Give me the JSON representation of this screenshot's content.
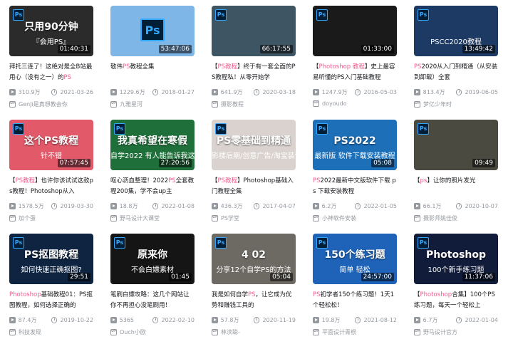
{
  "colors": {
    "highlight": "#f25d8e",
    "meta": "#9499a0",
    "ps_blue": "#31a8ff",
    "ps_dark": "#001e36"
  },
  "videos": [
    {
      "cover_text": "只用90分钟",
      "cover_sub": "『会用PS』",
      "duration": "01:40:31",
      "title_pre": "拜托三连了！这绝对是全B站最用心（没有之一）的",
      "title_hl": "PS",
      "title_post": "",
      "views": "310.9万",
      "date": "2021-03-26",
      "author": "GenJi是真想教会你",
      "bg": "#2b2b2b"
    },
    {
      "cover_text": "",
      "cover_sub": "",
      "duration": "53:47:06",
      "title_pre": "敬伟",
      "title_hl": "PS",
      "title_post": "教程全集",
      "views": "1229.6万",
      "date": "2018-01-27",
      "author": "九雅星河",
      "bg": "#7fb6e8"
    },
    {
      "cover_text": "",
      "cover_sub": "",
      "duration": "66:17:55",
      "title_pre": "【",
      "title_hl": "PS教程",
      "title_post": "】终于有一套全面的PS教程私！从零开始学",
      "views": "641.9万",
      "date": "2020-03-18",
      "author": "摄影教程",
      "bg": "#3e5563"
    },
    {
      "cover_text": "",
      "cover_sub": "",
      "duration": "01:33:00",
      "title_pre": "【",
      "title_hl": "Photoshop 教程",
      "title_post": "】史上最容易听懂的PS入门基础教程",
      "views": "1247.9万",
      "date": "2016-05-03",
      "author": "doyoudo",
      "bg": "#1a1a1a"
    },
    {
      "cover_text": "",
      "cover_sub": "PSCC2020教程",
      "duration": "13:49:42",
      "title_pre": "",
      "title_hl": "PS",
      "title_post": "2020从入门到精通（从安装到卸载）全套",
      "views": "813.4万",
      "date": "2019-06-05",
      "author": "梦亿少年时",
      "bg": "#1c3a63"
    },
    {
      "cover_text": "这个PS教程",
      "cover_sub": "针不错",
      "duration": "07:57:45",
      "title_pre": "【",
      "title_hl": "PS教程",
      "title_post": "】也许你该试试这款ps教程！Photoshop从入",
      "views": "1578.5万",
      "date": "2019-03-30",
      "author": "加个蛋",
      "bg": "#e25a6a"
    },
    {
      "cover_text": "我真希望在寒假",
      "cover_sub": "自学2022 有人能告诉我这些",
      "duration": "27:20:56",
      "title_pre": "呕心沥血整理！2022",
      "title_hl": "PS",
      "title_post": "全套教程200集，学不会up主",
      "views": "18.8万",
      "date": "2022-01-08",
      "author": "野马设计大课堂",
      "bg": "#1f6f3a"
    },
    {
      "cover_text": "PS零基础到精通",
      "cover_sub": "影楼后期/创意广告/淘宝装修",
      "duration": "",
      "title_pre": "【",
      "title_hl": "PS教程",
      "title_post": "】Photoshop基础入门教程全集",
      "views": "436.3万",
      "date": "2017-04-07",
      "author": "PS学堂",
      "bg": "#d9d2cf"
    },
    {
      "cover_text": "PS2022",
      "cover_sub": "最新版 软件下载安装教程",
      "duration": "05:08",
      "title_pre": "",
      "title_hl": "PS",
      "title_post": "2022最新中文版软件下载 ps 下载安装教程",
      "views": "6.2万",
      "date": "2022-01-05",
      "author": "小神软件安装",
      "bg": "#1d6fb8"
    },
    {
      "cover_text": "",
      "cover_sub": "",
      "duration": "09:49",
      "title_pre": "【",
      "title_hl": "ps",
      "title_post": "】让你的照片发光",
      "views": "66.1万",
      "date": "2020-10-07",
      "author": "摄影师姚佳俊",
      "bg": "#4a4a40"
    },
    {
      "cover_text": "PS抠图教程",
      "cover_sub": "如何快速正确抠图?",
      "duration": "29:51",
      "title_pre": "",
      "title_hl": "Photoshop",
      "title_post": "基础教程01：PS抠图教程，如何选择正确的",
      "views": "87.4万",
      "date": "2019-10-22",
      "author": "科技发现",
      "bg": "#0e2440"
    },
    {
      "cover_text": "原来你",
      "cover_sub": "不会白嫖素材",
      "duration": "01:45",
      "title_pre": "笔刷白嫖攻略：这几个网站让你不再担心没笔刷用！",
      "title_hl": "",
      "title_post": "",
      "views": "5365",
      "date": "2022-02-10",
      "author": "Ouch小欧",
      "bg": "#151515"
    },
    {
      "cover_text": "4 02",
      "cover_sub": "分享12个自学PS的方法",
      "duration": "05:04",
      "title_pre": "我是如何自学",
      "title_hl": "PS",
      "title_post": "，让它成为优势和赚钱工具的",
      "views": "57.8万",
      "date": "2020-11-19",
      "author": "林滨聪-",
      "bg": "#6d6a64"
    },
    {
      "cover_text": "150个练习题",
      "cover_sub": "简单 轻松",
      "duration": "24:57:00",
      "title_pre": "",
      "title_hl": "PS",
      "title_post": "初学者150个练习题！1天1个轻松松！",
      "views": "19.8万",
      "date": "2021-08-12",
      "author": "平面设计青根",
      "bg": "#1e63b8"
    },
    {
      "cover_text": "Photoshop",
      "cover_sub": "100个新手练习题",
      "duration": "11:37:06",
      "title_pre": "【",
      "title_hl": "Photoshop",
      "title_post": "合集】100个PS练习题，每天一个轻松上",
      "views": "6.7万",
      "date": "2022-01-04",
      "author": "野马设计官方",
      "bg": "#111b3a"
    }
  ]
}
